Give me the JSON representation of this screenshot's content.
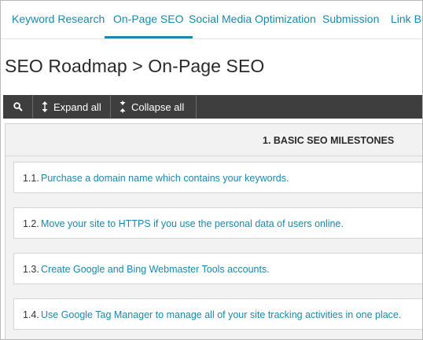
{
  "tabs": [
    {
      "label": "Keyword Research",
      "active": false
    },
    {
      "label": "On-Page SEO",
      "active": true
    },
    {
      "label": "Social Media Optimization",
      "active": false
    },
    {
      "label": "Submission",
      "active": false
    },
    {
      "label": "Link Bu",
      "active": false
    }
  ],
  "page": {
    "title": "SEO Roadmap > On-Page SEO"
  },
  "toolbar": {
    "search_icon": "search-icon",
    "expand_label": "Expand all",
    "collapse_label": "Collapse all"
  },
  "section": {
    "title": "1. BASIC SEO MILESTONES",
    "items": [
      {
        "num": "1.1.",
        "text": "Purchase a domain name which contains your keywords."
      },
      {
        "num": "1.2.",
        "text": "Move your site to HTTPS if you use the personal data of users online."
      },
      {
        "num": "1.3.",
        "text": "Create Google and Bing Webmaster Tools accounts."
      },
      {
        "num": "1.4.",
        "text": "Use Google Tag Manager to manage all of your site tracking activities in one place."
      }
    ]
  },
  "colors": {
    "accent": "#1d87ab",
    "toolbar": "#3e3e3e"
  }
}
